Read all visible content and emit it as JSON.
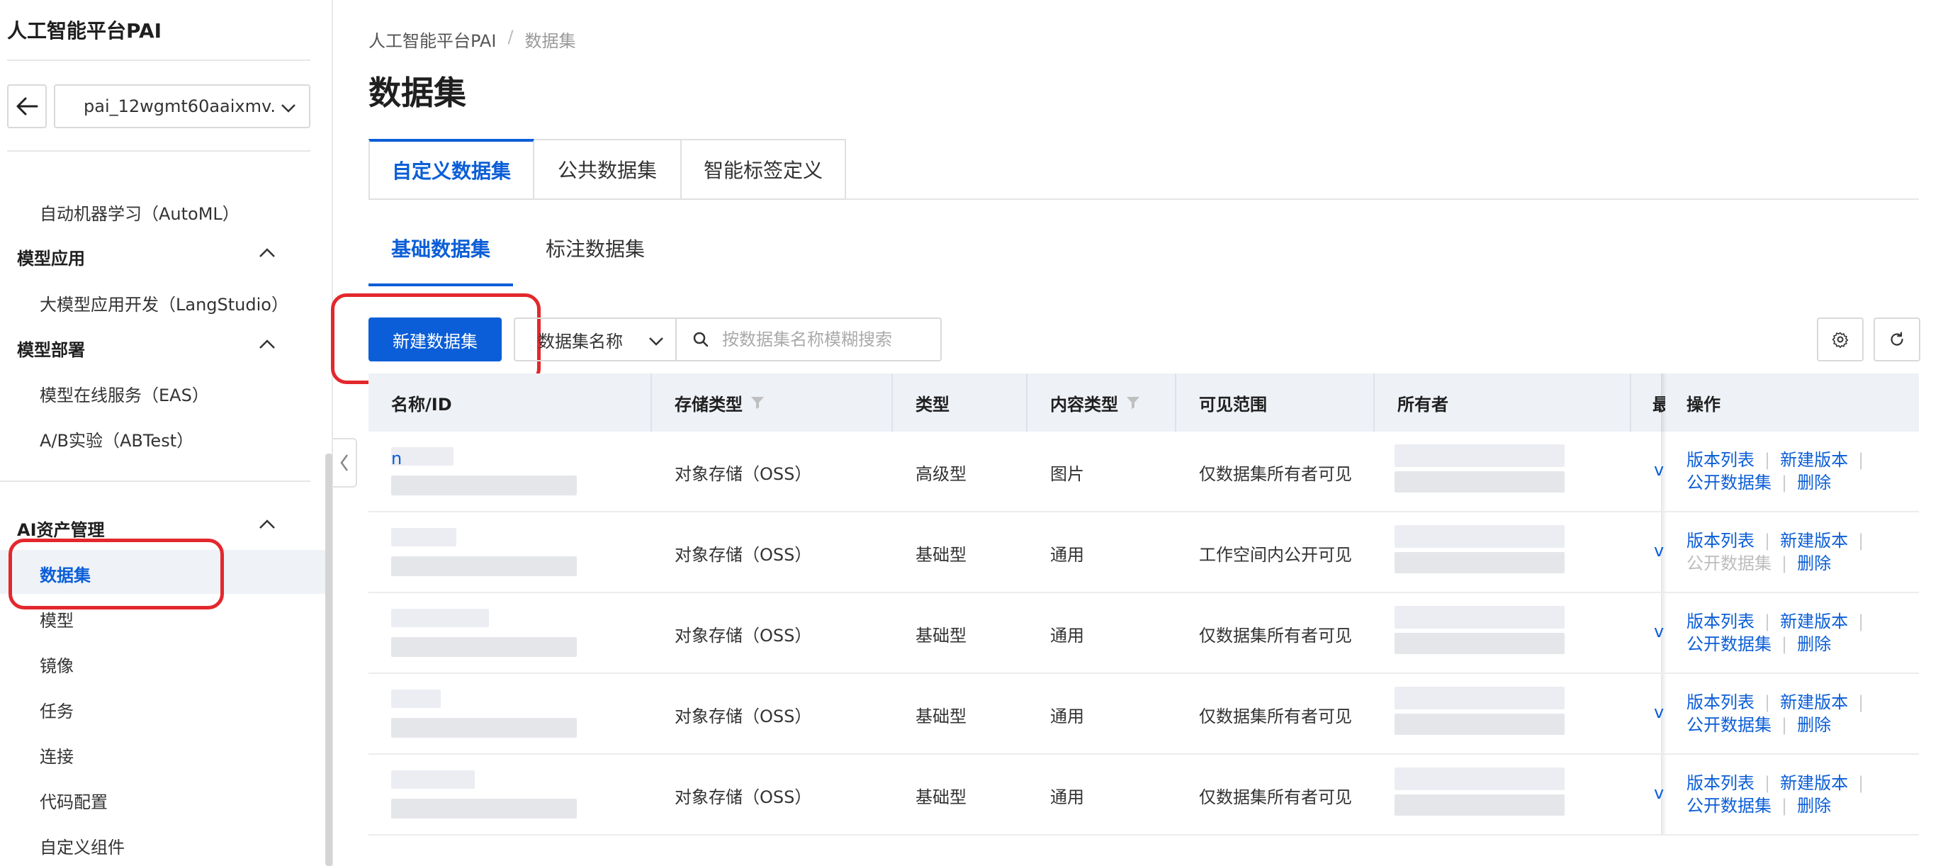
{
  "sidebar": {
    "app_title": "人工智能平台PAI",
    "workspace": "pai_12wgmt60aaixmv.",
    "items": {
      "automl": "自动机器学习（AutoML）",
      "group_model_app": "模型应用",
      "langstudio": "大模型应用开发（LangStudio）",
      "group_deploy": "模型部署",
      "eas": "模型在线服务（EAS）",
      "abtest": "A/B实验（ABTest）",
      "group_assets": "AI资产管理",
      "dataset": "数据集",
      "model": "模型",
      "image": "镜像",
      "task": "任务",
      "connection": "连接",
      "code_config": "代码配置",
      "custom_component": "自定义组件"
    }
  },
  "breadcrumb": {
    "root": "人工智能平台PAI",
    "sep": "/",
    "current": "数据集"
  },
  "page_title": "数据集",
  "tabs": [
    "自定义数据集",
    "公共数据集",
    "智能标签定义"
  ],
  "subtabs": [
    "基础数据集",
    "标注数据集"
  ],
  "toolbar": {
    "new_button": "新建数据集",
    "filter_field": "数据集名称",
    "search_placeholder": "按数据集名称模糊搜索"
  },
  "table": {
    "headers": {
      "name": "名称/ID",
      "storage": "存储类型",
      "type": "类型",
      "content": "内容类型",
      "visibility": "可见范围",
      "owner": "所有者",
      "truncated": "最",
      "ops": "操作"
    },
    "rows": [
      {
        "name": "n",
        "storage": "对象存储（OSS）",
        "type": "高级型",
        "content": "图片",
        "visibility": "仅数据集所有者可见",
        "version": "v",
        "publish_disabled": false
      },
      {
        "name": "",
        "storage": "对象存储（OSS）",
        "type": "基础型",
        "content": "通用",
        "visibility": "工作空间内公开可见",
        "version": "v",
        "publish_disabled": true
      },
      {
        "name": "",
        "storage": "对象存储（OSS）",
        "type": "基础型",
        "content": "通用",
        "visibility": "仅数据集所有者可见",
        "version": "v",
        "publish_disabled": false
      },
      {
        "name": "",
        "storage": "对象存储（OSS）",
        "type": "基础型",
        "content": "通用",
        "visibility": "仅数据集所有者可见",
        "version": "v",
        "publish_disabled": false
      },
      {
        "name": "",
        "storage": "对象存储（OSS）",
        "type": "基础型",
        "content": "通用",
        "visibility": "仅数据集所有者可见",
        "version": "v",
        "publish_disabled": false
      }
    ],
    "ops_labels": {
      "version_list": "版本列表",
      "new_version": "新建版本",
      "publish": "公开数据集",
      "delete": "删除",
      "bar": "|"
    }
  },
  "colors": {
    "accent": "#0b5ed7",
    "highlight": "#e3282d",
    "header_bg": "#eef1f6"
  }
}
